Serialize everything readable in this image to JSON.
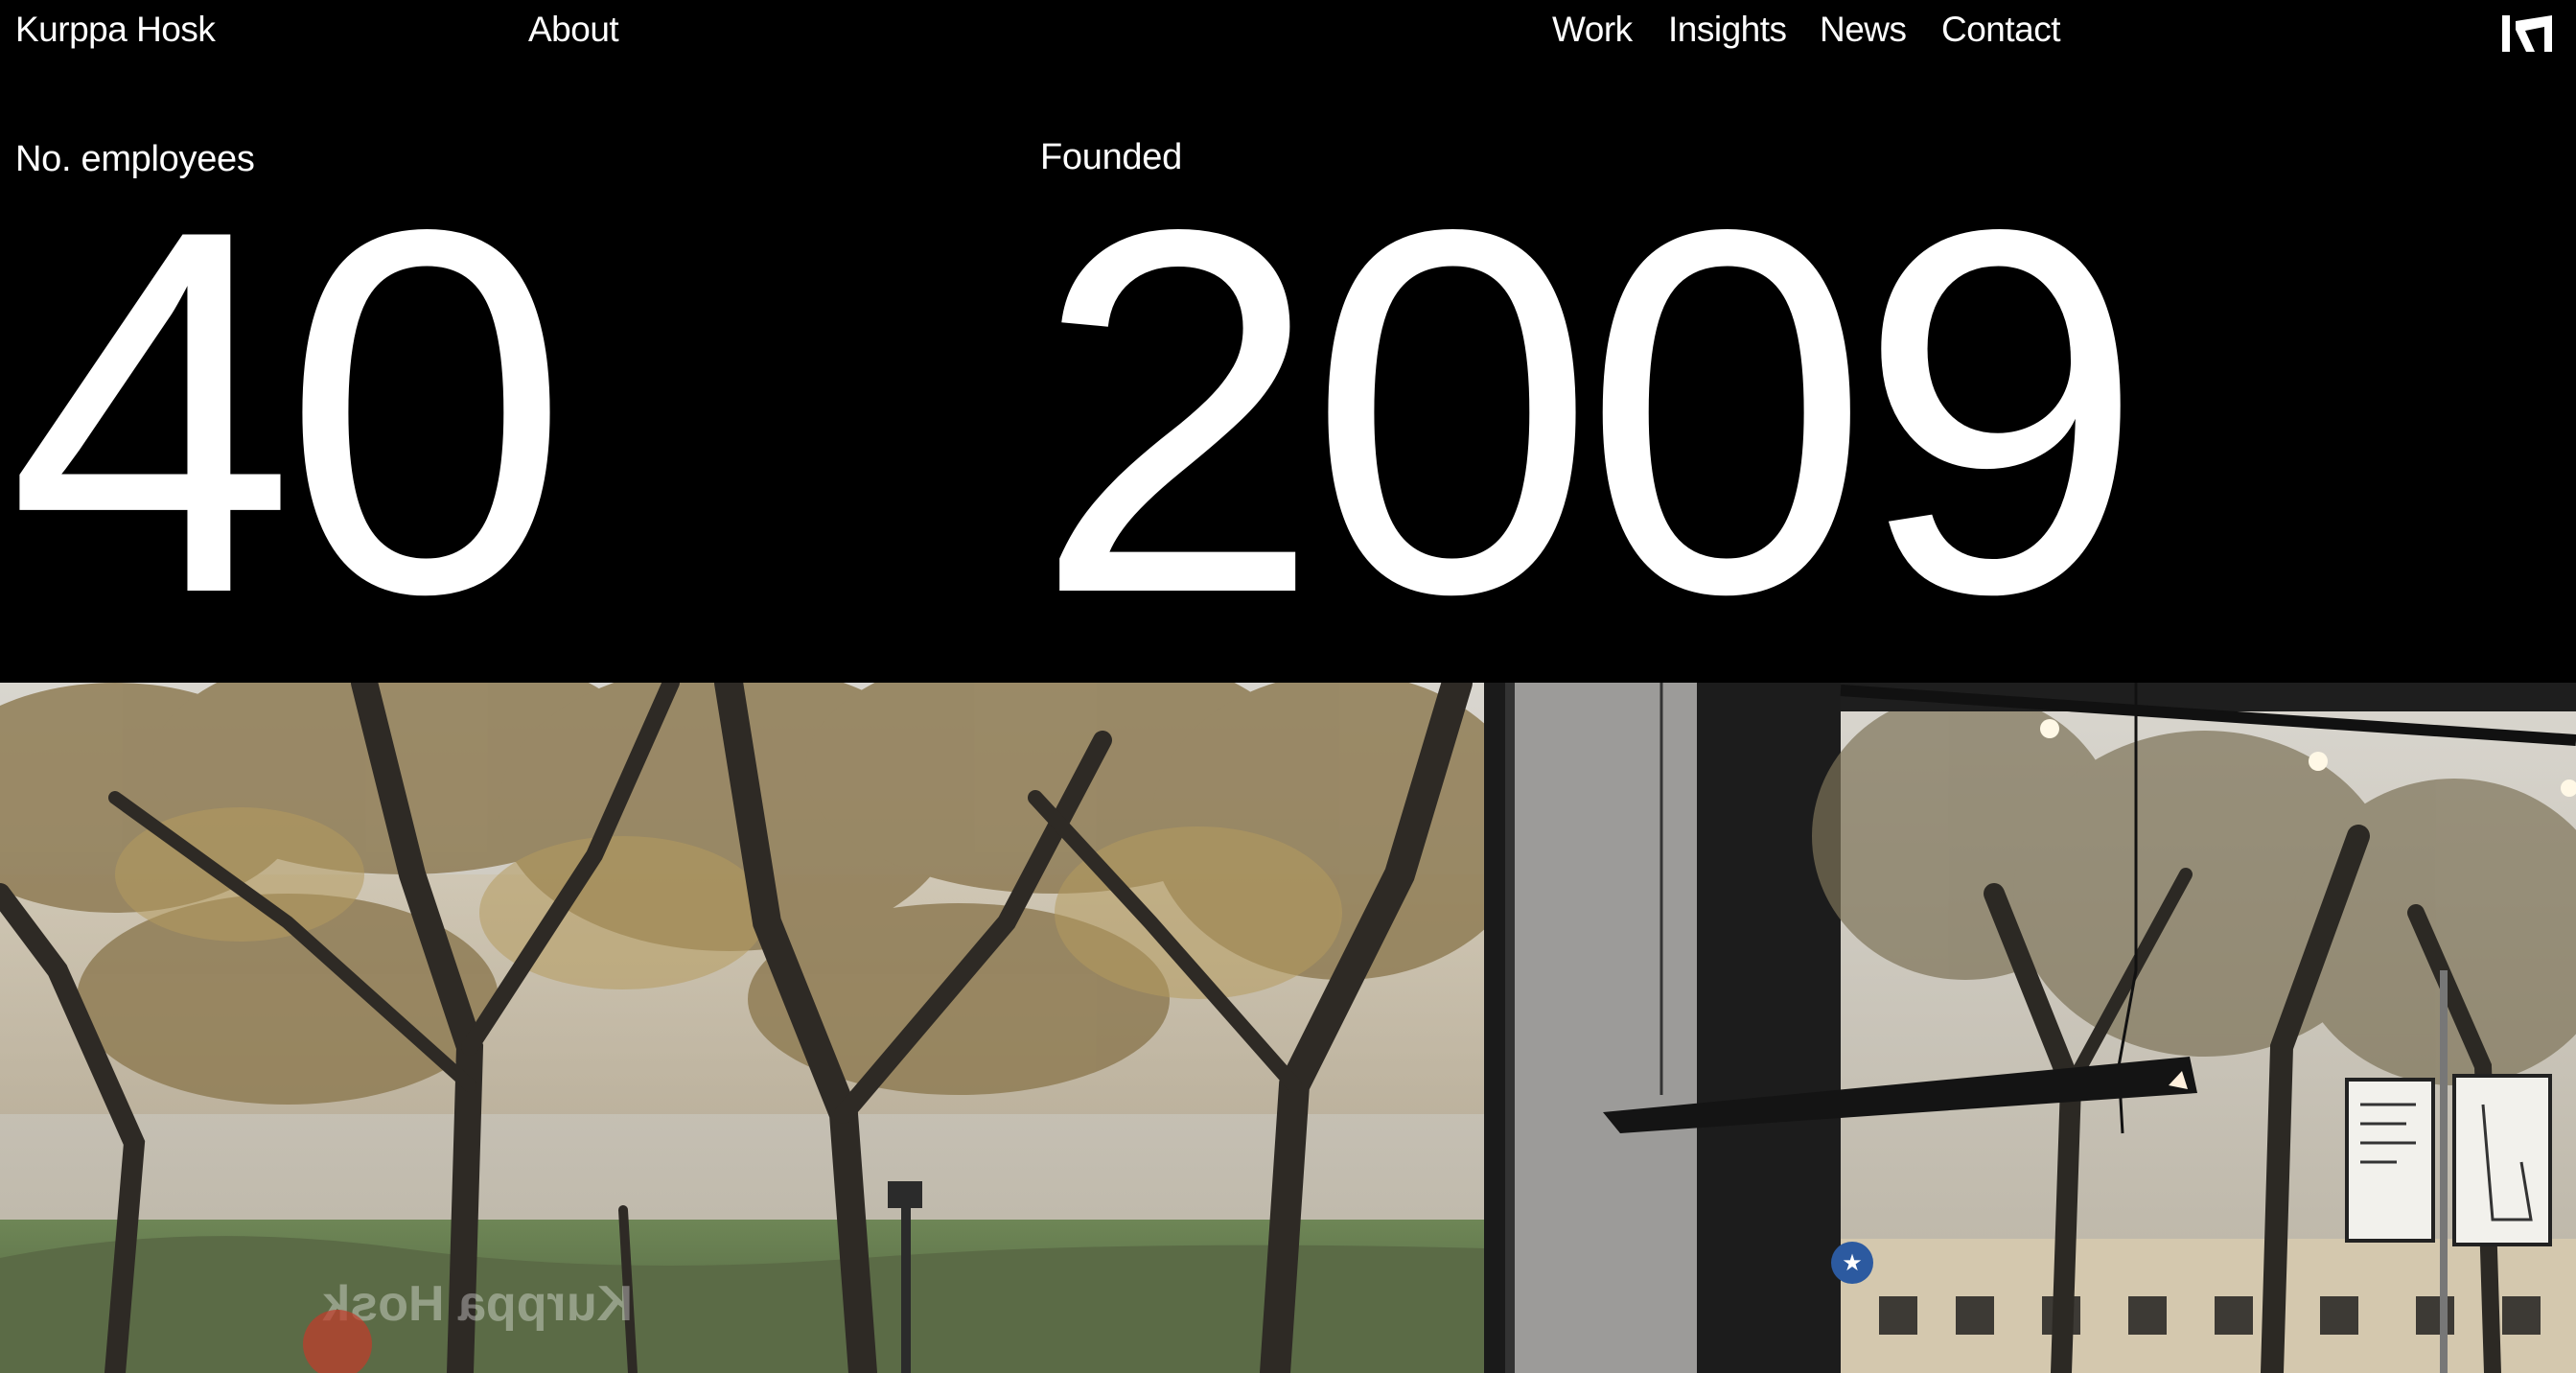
{
  "nav": {
    "brand": "Kurppa Hosk",
    "about": "About",
    "links": [
      "Work",
      "Insights",
      "News",
      "Contact"
    ],
    "logo_icon": "kh-monogram-icon"
  },
  "stats": [
    {
      "label": "No. employees",
      "value": "40"
    },
    {
      "label": "Founded",
      "value": "2009"
    }
  ],
  "photo": {
    "window_text": "Kurppa Hosk",
    "icon": "office-window-photo"
  },
  "colors": {
    "background": "#000000",
    "text": "#ffffff"
  }
}
